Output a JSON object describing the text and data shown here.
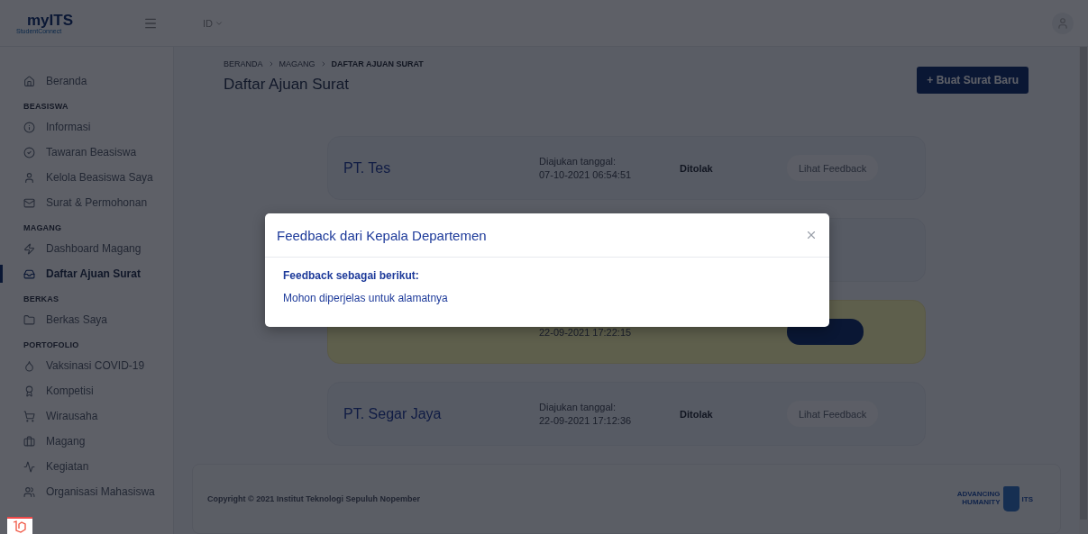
{
  "topbar": {
    "logo": {
      "title": "myITS",
      "subtitle": "StudentConnect"
    },
    "language": "ID"
  },
  "sidebar": [
    {
      "kind": "item",
      "label": "Beranda",
      "selected": false
    },
    {
      "kind": "heading",
      "label": "BEASISWA"
    },
    {
      "kind": "item",
      "label": "Informasi",
      "selected": false
    },
    {
      "kind": "item",
      "label": "Tawaran Beasiswa",
      "selected": false
    },
    {
      "kind": "item",
      "label": "Kelola Beasiswa Saya",
      "selected": false
    },
    {
      "kind": "item",
      "label": "Surat & Permohonan",
      "selected": false
    },
    {
      "kind": "heading",
      "label": "MAGANG"
    },
    {
      "kind": "item",
      "label": "Dashboard Magang",
      "selected": false
    },
    {
      "kind": "item",
      "label": "Daftar Ajuan Surat",
      "selected": true
    },
    {
      "kind": "heading",
      "label": "BERKAS"
    },
    {
      "kind": "item",
      "label": "Berkas Saya",
      "selected": false
    },
    {
      "kind": "heading",
      "label": "PORTOFOLIO"
    },
    {
      "kind": "item",
      "label": "Vaksinasi COVID-19",
      "selected": false
    },
    {
      "kind": "item",
      "label": "Kompetisi",
      "selected": false
    },
    {
      "kind": "item",
      "label": "Wirausaha",
      "selected": false
    },
    {
      "kind": "item",
      "label": "Magang",
      "selected": false
    },
    {
      "kind": "item",
      "label": "Kegiatan",
      "selected": false
    },
    {
      "kind": "item",
      "label": "Organisasi Mahasiswa",
      "selected": false
    }
  ],
  "breadcrumb": [
    "BERANDA",
    "MAGANG",
    "DAFTAR AJUAN SURAT"
  ],
  "page_title": "Daftar Ajuan Surat",
  "new_button": "+ Buat Surat Baru",
  "submissions": [
    {
      "name": "PT. Tes",
      "date_label": "Diajukan tanggal:",
      "date": "07-10-2021 06:54:51",
      "status": "Ditolak",
      "action": {
        "kind": "light",
        "label": "Lihat Feedback"
      },
      "highlighted": false
    },
    {
      "highlighted": false
    },
    {
      "date": "22-09-2021 17:22:15",
      "action": {
        "kind": "primary"
      },
      "highlighted": true
    },
    {
      "name": "PT. Segar Jaya",
      "date_label": "Diajukan tanggal:",
      "date": "22-09-2021 17:12:36",
      "status": "Ditolak",
      "action": {
        "kind": "light",
        "label": "Lihat Feedback"
      },
      "highlighted": false
    }
  ],
  "footer": {
    "copyright": "Copyright © 2021 Institut Teknologi Sepuluh Nopember",
    "logo_text": [
      "ADVANCING",
      "HUMANITY"
    ],
    "logo_mark": "ITS"
  },
  "modal": {
    "title": "Feedback dari Kepala Departemen",
    "heading": "Feedback sebagai berikut:",
    "message": "Mohon diperjelas untuk alamatnya"
  }
}
